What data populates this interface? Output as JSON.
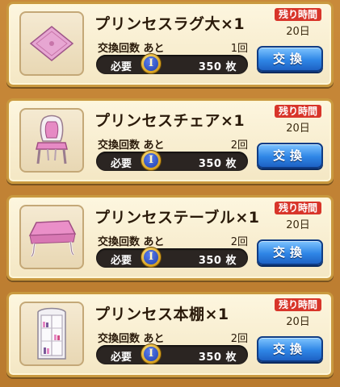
{
  "items": [
    {
      "name": "プリンセスラグ大×1",
      "remaining_label": "残り時間",
      "remaining_days": "20日",
      "count_label": "交換回数 あと",
      "count_value": "1回",
      "required_label": "必要",
      "medal_symbol": "I",
      "required_amount": "350 枚",
      "button_label": "交換",
      "icon": "pink-rug-icon"
    },
    {
      "name": "プリンセスチェア×1",
      "remaining_label": "残り時間",
      "remaining_days": "20日",
      "count_label": "交換回数 あと",
      "count_value": "2回",
      "required_label": "必要",
      "medal_symbol": "I",
      "required_amount": "350 枚",
      "button_label": "交換",
      "icon": "pink-chair-icon"
    },
    {
      "name": "プリンセステーブル×1",
      "remaining_label": "残り時間",
      "remaining_days": "20日",
      "count_label": "交換回数 あと",
      "count_value": "2回",
      "required_label": "必要",
      "medal_symbol": "I",
      "required_amount": "350 枚",
      "button_label": "交換",
      "icon": "pink-table-icon"
    },
    {
      "name": "プリンセス本棚×1",
      "remaining_label": "残り時間",
      "remaining_days": "20日",
      "count_label": "交換回数 あと",
      "count_value": "2回",
      "required_label": "必要",
      "medal_symbol": "I",
      "required_amount": "350 枚",
      "button_label": "交換",
      "icon": "bookshelf-icon"
    }
  ],
  "colors": {
    "remaining_badge": "#d8352a",
    "exchange_button": "#2f86e6",
    "card_background": "#fdf6df",
    "frame": "#c9993f"
  }
}
